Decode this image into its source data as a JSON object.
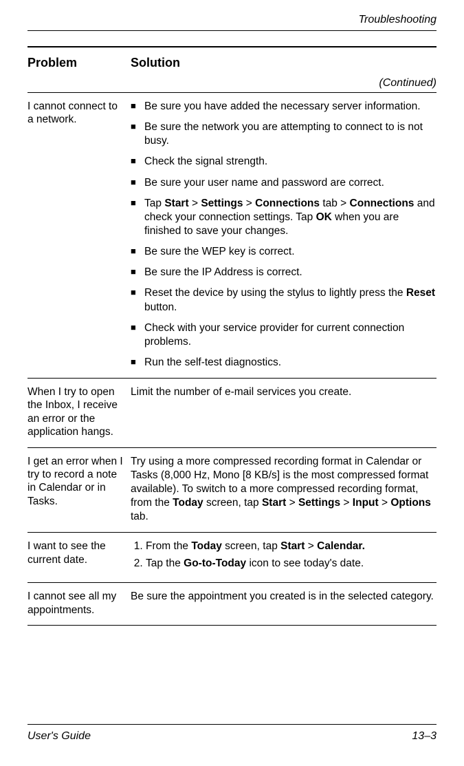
{
  "header": {
    "section": "Troubleshooting"
  },
  "table": {
    "col1": "Problem",
    "col2": "Solution",
    "continued": "(Continued)"
  },
  "rows": {
    "r1": {
      "problem": "I cannot connect to a network.",
      "b1": "Be sure you have added the necessary server information.",
      "b2": "Be sure the network you are attempting to connect to is not busy.",
      "b3": "Check the signal strength.",
      "b4": "Be sure your user name and password are correct.",
      "b5_pre": "Tap ",
      "b5_start": "Start",
      "b5_gt1": " > ",
      "b5_settings": "Settings",
      "b5_gt2": " > ",
      "b5_conn_tab": "Connections",
      "b5_tab_word": " tab > ",
      "b5_conn2": "Connections",
      "b5_mid": " and check your connection settings. Tap ",
      "b5_ok": "OK",
      "b5_end": " when you are finished to save your changes.",
      "b6": "Be sure the WEP key is correct.",
      "b7": "Be sure the IP Address is correct.",
      "b8_pre": "Reset the device by using the stylus to lightly press the ",
      "b8_reset": "Reset",
      "b8_post": " button.",
      "b9": "Check with your service provider for current connection problems.",
      "b10": "Run the self-test diagnostics."
    },
    "r2": {
      "problem": "When I try to open the Inbox, I receive an error or the application hangs.",
      "solution": "Limit the number of e-mail services you create."
    },
    "r3": {
      "problem": "I get an error when I try to record a note in Calendar or in Tasks.",
      "s_pre": "Try using a more compressed recording format in Calendar or Tasks (8,000 Hz, Mono [8 KB/s] is the most compressed format available). To switch to a more compressed recording format, from the ",
      "s_today": "Today",
      "s_mid1": " screen, tap ",
      "s_start": "Start",
      "s_gt1": " > ",
      "s_settings": "Settings",
      "s_gt2": " > ",
      "s_input": "Input",
      "s_gt3": " > ",
      "s_options": "Options",
      "s_post": " tab."
    },
    "r4": {
      "problem": "I want to see the current date.",
      "l1_pre": "From the ",
      "l1_today": "Today",
      "l1_mid": " screen, tap ",
      "l1_start": "Start",
      "l1_gt": " > ",
      "l1_cal": "Calendar.",
      "l2_pre": "Tap the ",
      "l2_goto": "Go-to-Today",
      "l2_post": " icon to see today's date."
    },
    "r5": {
      "problem": "I cannot see all my appointments.",
      "solution": "Be sure the appointment you created is in the selected category."
    }
  },
  "footer": {
    "left": "User's Guide",
    "right": "13–3"
  }
}
